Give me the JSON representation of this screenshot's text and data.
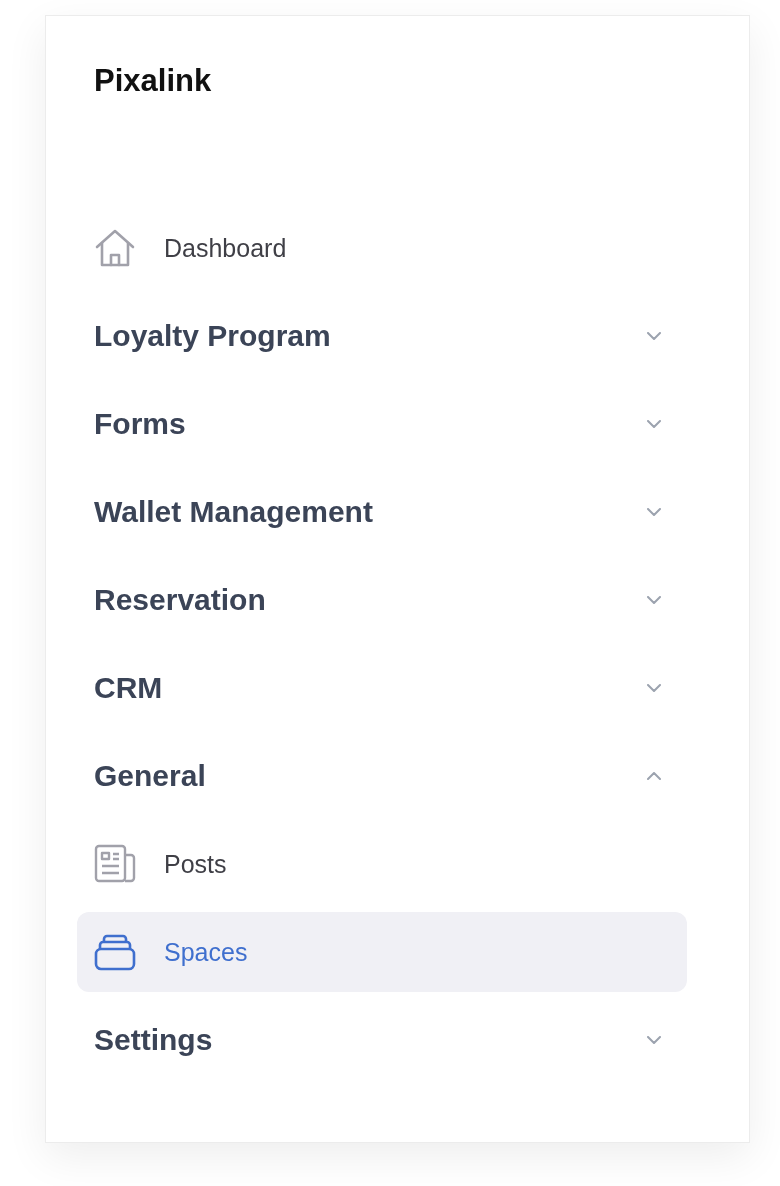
{
  "brand": "Pixalink",
  "nav": [
    {
      "kind": "link",
      "label": "Dashboard",
      "selected": false
    },
    {
      "kind": "section",
      "label": "Loyalty Program",
      "expanded": false
    },
    {
      "kind": "section",
      "label": "Forms",
      "expanded": false
    },
    {
      "kind": "section",
      "label": "Wallet Management",
      "expanded": false
    },
    {
      "kind": "section",
      "label": "Reservation",
      "expanded": false
    },
    {
      "kind": "section",
      "label": "CRM",
      "expanded": false
    },
    {
      "kind": "section",
      "label": "General",
      "expanded": true,
      "children": [
        {
          "kind": "link",
          "label": "Posts",
          "selected": false
        },
        {
          "kind": "link",
          "label": "Spaces",
          "selected": true
        }
      ]
    },
    {
      "kind": "section",
      "label": "Settings",
      "expanded": false
    }
  ]
}
